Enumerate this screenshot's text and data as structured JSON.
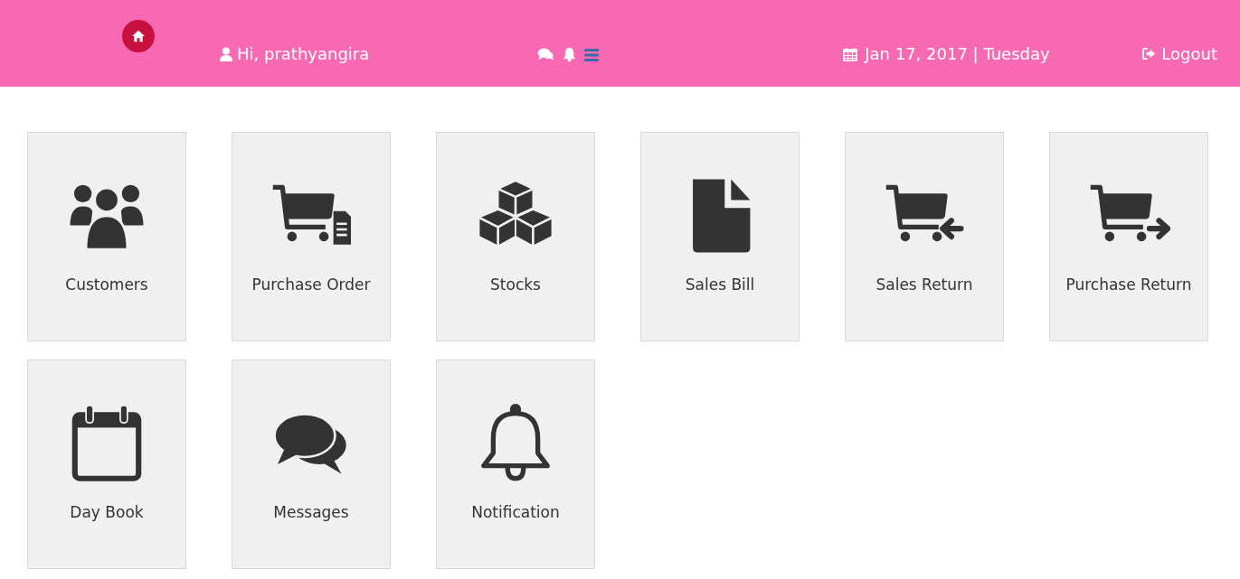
{
  "header": {
    "greeting": "Hi, prathyangira",
    "date": "Jan 17, 2017 | Tuesday",
    "logout": "Logout"
  },
  "tiles": [
    {
      "label": "Customers",
      "kind": "users"
    },
    {
      "label": "Purchase Order",
      "kind": "cart-doc"
    },
    {
      "label": "Stocks",
      "kind": "cubes"
    },
    {
      "label": "Sales Bill",
      "kind": "file"
    },
    {
      "label": "Sales Return",
      "kind": "cart-left"
    },
    {
      "label": "Purchase Return",
      "kind": "cart-right"
    },
    {
      "label": "Day Book",
      "kind": "calendar"
    },
    {
      "label": "Messages",
      "kind": "comments"
    },
    {
      "label": "Notification",
      "kind": "bell"
    }
  ]
}
